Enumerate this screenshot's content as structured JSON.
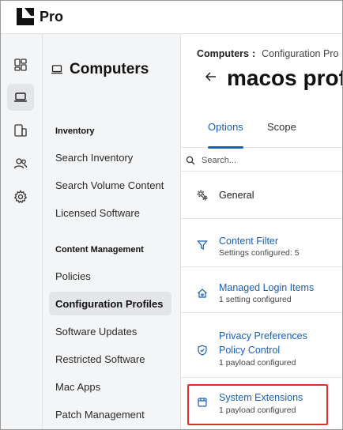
{
  "app": {
    "brand": "Pro"
  },
  "rail": {
    "items": [
      {
        "icon": "dashboard-icon",
        "active": false
      },
      {
        "icon": "laptop-icon",
        "active": true
      },
      {
        "icon": "devices-icon",
        "active": false
      },
      {
        "icon": "users-icon",
        "active": false
      },
      {
        "icon": "gear-icon",
        "active": false
      }
    ]
  },
  "nav": {
    "title": "Computers",
    "sections": [
      {
        "label": "Inventory"
      },
      {
        "label": "Content Management"
      }
    ],
    "items": [
      {
        "label": "Search Inventory"
      },
      {
        "label": "Search Volume Content"
      },
      {
        "label": "Licensed Software"
      },
      {
        "label": "Policies"
      },
      {
        "label": "Configuration Profiles"
      },
      {
        "label": "Software Updates"
      },
      {
        "label": "Restricted Software"
      },
      {
        "label": "Mac Apps"
      },
      {
        "label": "Patch Management"
      }
    ]
  },
  "main": {
    "breadcrumb": {
      "root": "Computers",
      "separator": ":",
      "current": "Configuration Pro"
    },
    "title": "macos prof",
    "tabs": [
      {
        "label": "Options"
      },
      {
        "label": "Scope"
      }
    ],
    "search": {
      "placeholder": "Search..."
    },
    "payloads": [
      {
        "title": "General",
        "subtitle": "",
        "icon": "general-settings-icon"
      },
      {
        "title": "Content Filter",
        "subtitle": "Settings configured: 5",
        "icon": "filter-icon"
      },
      {
        "title": "Managed Login Items",
        "subtitle": "1 setting configured",
        "icon": "home-icon"
      },
      {
        "title_line1": "Privacy Preferences",
        "title_line2": "Policy Control",
        "subtitle": "1 payload configured",
        "icon": "shield-icon"
      },
      {
        "title": "System Extensions",
        "subtitle": "1 payload configured",
        "icon": "extension-icon"
      }
    ]
  },
  "colors": {
    "accent": "#1a5fb4",
    "highlight": "#e0302b",
    "sidebar_bg": "#f4f5f6"
  }
}
